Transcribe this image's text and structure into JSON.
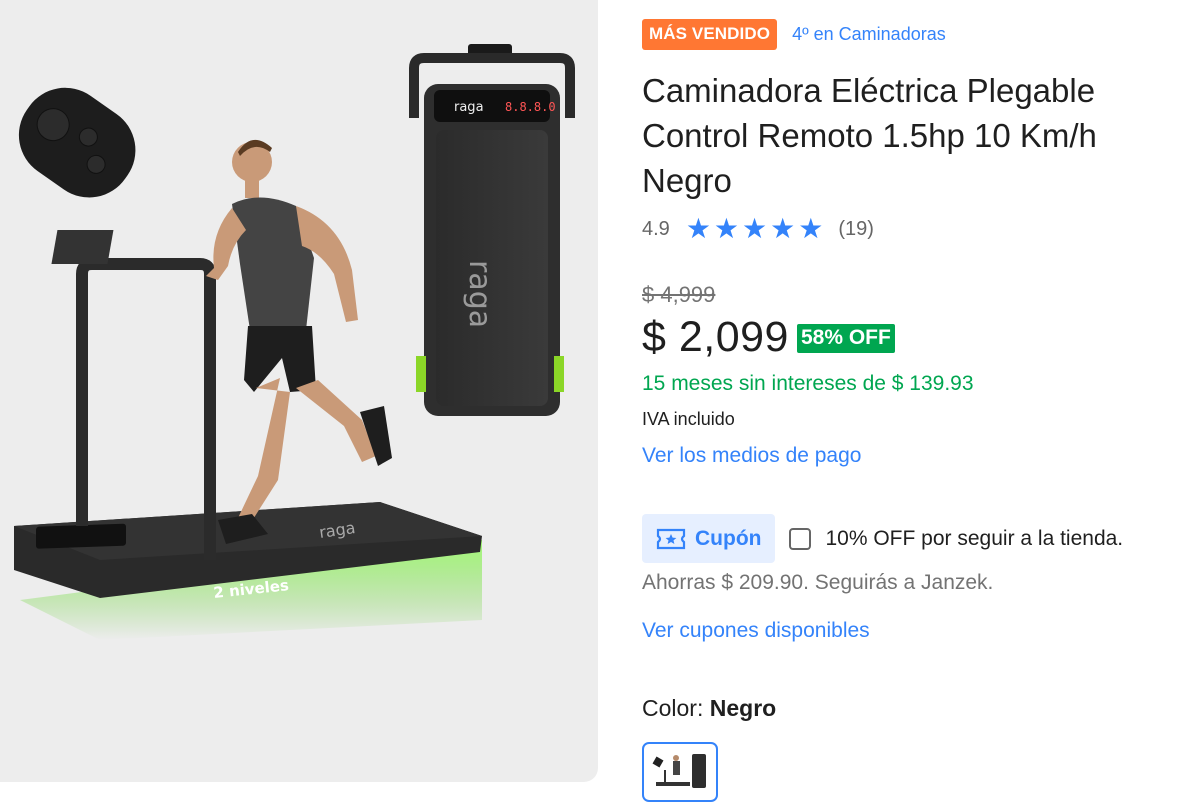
{
  "image": {
    "logo_text": "raga",
    "display_text": "8.8.8.0",
    "levels_label": "2 niveles"
  },
  "badges": {
    "best_seller": "MÁS VENDIDO",
    "ranking": "4º en Caminadoras"
  },
  "product": {
    "title": "Caminadora Eléctrica Plegable Control Remoto 1.5hp 10 Km/h Negro"
  },
  "rating": {
    "score": "4.9",
    "stars": 5,
    "count": "(19)"
  },
  "price": {
    "original": "$ 4,999",
    "current": "$ 2,099",
    "discount": "58% OFF",
    "installments": "15 meses sin intereses de $ 139.93",
    "tax_note": "IVA incluido",
    "payment_methods_link": "Ver los medios de pago"
  },
  "coupon": {
    "button_label": "Cupón",
    "offer_text": "10% OFF por seguir a la tienda.",
    "savings_text": "Ahorras $ 209.90. Seguirás a Janzek.",
    "available_link": "Ver cupones disponibles"
  },
  "variant": {
    "color_label": "Color:",
    "color_value": "Negro"
  },
  "colors": {
    "accent": "#3483fa",
    "best_seller": "#ff7733",
    "discount": "#00a650",
    "installments": "#00a650"
  }
}
